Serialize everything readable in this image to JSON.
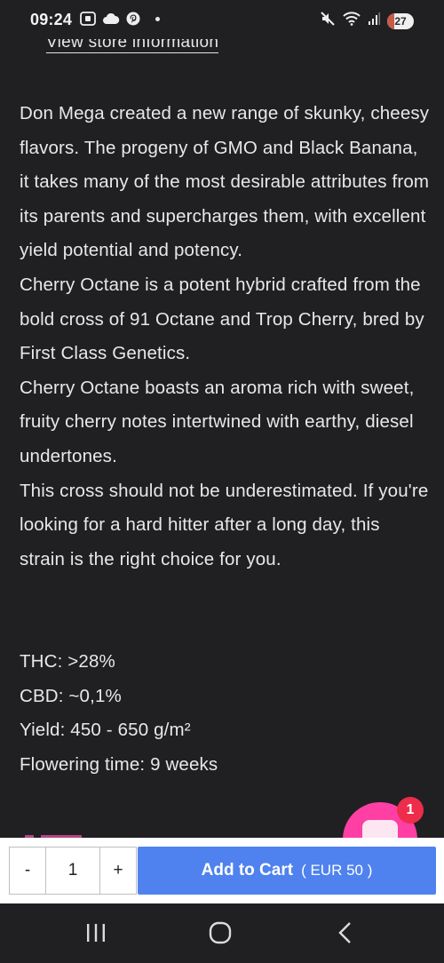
{
  "status_bar": {
    "time": "09:24",
    "battery_level": "27",
    "battery_fraction": 0.27,
    "left_icons": [
      "screenshot-icon",
      "cloud-icon",
      "pinterest-icon",
      "notification-dot"
    ],
    "right_icons": [
      "mute-icon",
      "wifi-icon",
      "signal-icon",
      "battery-icon"
    ]
  },
  "product": {
    "store_link": "View store information",
    "description": [
      "Don Mega created a new range of skunky, cheesy flavors. The progeny of GMO and Black Banana, it takes many of the most desirable attributes from its parents and supercharges them, with excellent yield potential and potency.",
      "Cherry Octane is a potent hybrid crafted from the bold cross of 91 Octane and Trop Cherry, bred by First Class Genetics.",
      "Cherry Octane boasts an aroma rich with sweet, fruity cherry notes intertwined with earthy, diesel undertones.",
      "This cross should not be underestimated. If you're looking for a hard hitter after a long day, this strain is the right choice for you."
    ],
    "specs": [
      "THC: >28%",
      "CBD: ~0,1%",
      "Yield: 450 - 650 g/m²",
      "Flowering time: 9 weeks"
    ]
  },
  "chat": {
    "badge_count": "1",
    "bubble_color": "#ff3fa4",
    "badge_color": "#ee2c4b"
  },
  "cart": {
    "minus_label": "-",
    "quantity": "1",
    "plus_label": "+",
    "add_label": "Add to Cart",
    "price_label": "( EUR 50 )",
    "button_color": "#4f82ee"
  },
  "navigation": {
    "buttons": [
      "recent-apps-icon",
      "home-icon",
      "back-icon"
    ]
  },
  "colors": {
    "background": "#202023",
    "text": "#e8e8ea",
    "link_partial": "#d64fa0"
  }
}
